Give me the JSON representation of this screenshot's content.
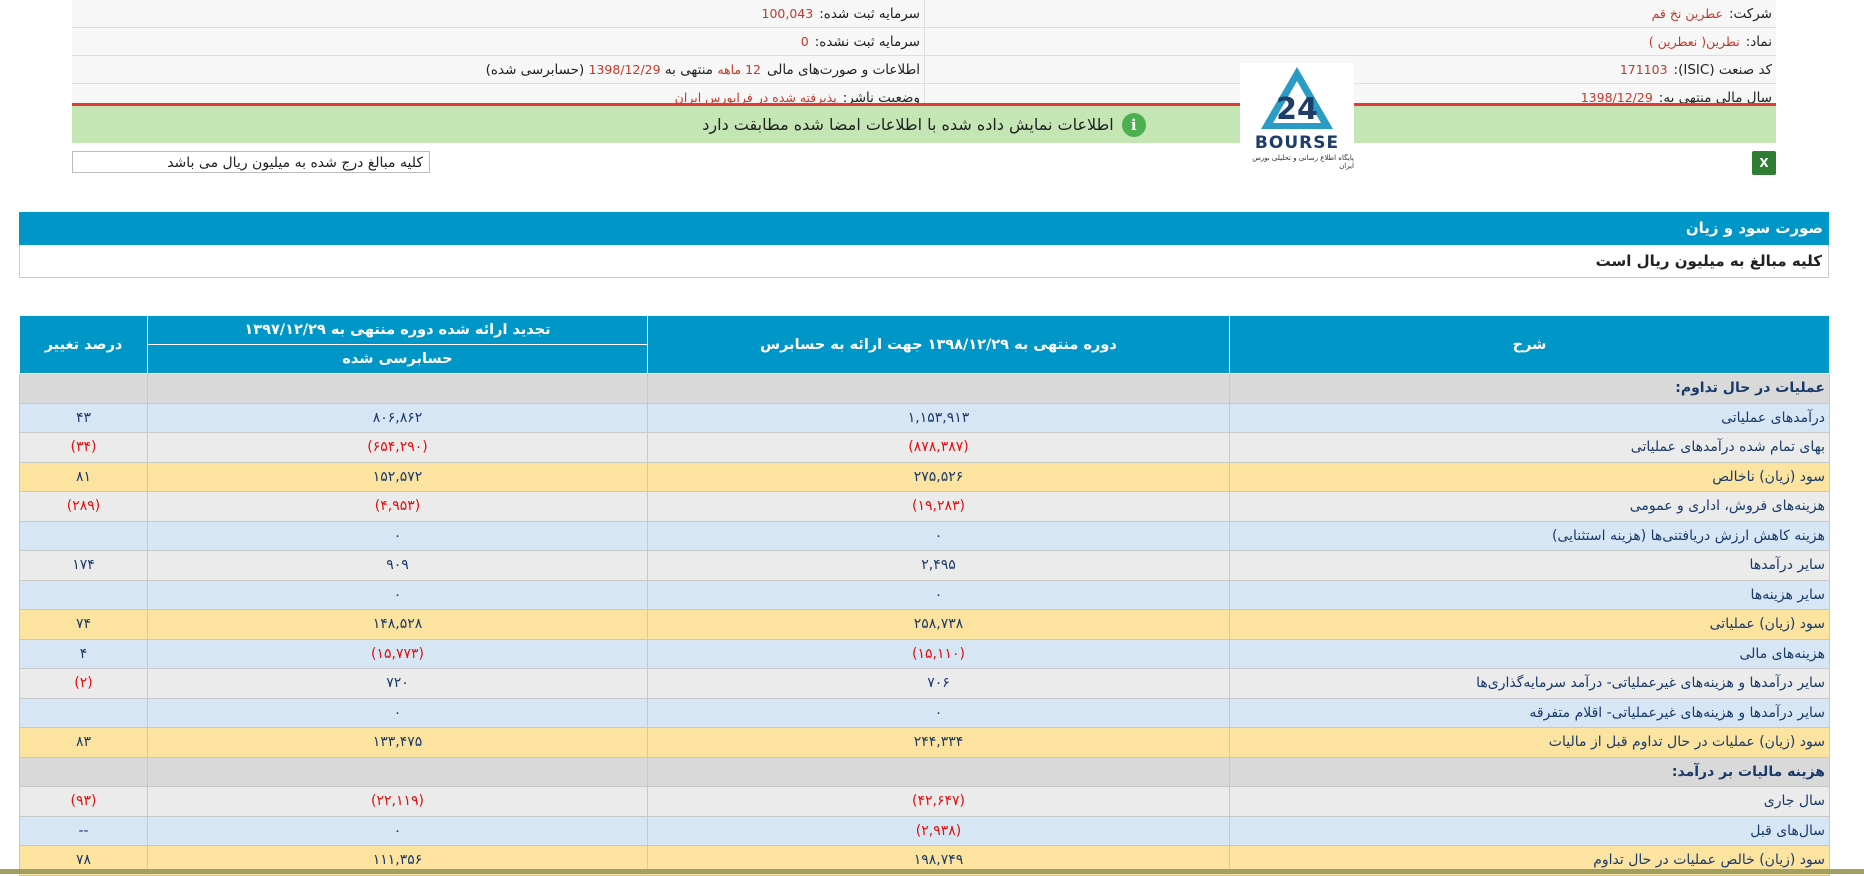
{
  "info": {
    "company_label": "شرکت:",
    "company_value": "عطرین نخ قم",
    "symbol_label": "نماد:",
    "symbol_value": "نطرین( نعطرین )",
    "isic_label": "کد صنعت (ISIC):",
    "isic_value": "171103",
    "fiscal_label": "سال مالی منتهی به:",
    "fiscal_value": "1398/12/29",
    "reg_capital_label": "سرمایه ثبت شده:",
    "reg_capital_value": "100,043",
    "unreg_capital_label": "سرمایه ثبت نشده:",
    "unreg_capital_value": "0",
    "statements_label": "اطلاعات و صورت‌های مالی",
    "statements_months": "12 ماهه",
    "statements_mid": "منتهی به",
    "statements_date": "1398/12/29",
    "statements_audit": "(حسابرسی شده)",
    "publisher_label": "وضعیت ناشر:",
    "publisher_value": "پذیرفته شده در فرابورس ایران"
  },
  "notice": "اطلاعات نمایش داده شده با اطلاعات امضا شده مطابقت دارد",
  "logo": {
    "word": "BOURSE",
    "sub": "پایگاه اطلاع رسانی و تحلیلی بورس ایران",
    "number": "24"
  },
  "unit_note": "کلیه مبالغ درج شده به میلیون ریال می باشد",
  "excel_icon": "X",
  "section_title": "صورت سود و زیان",
  "section_note": "کلیه مبالغ به میلیون ریال است",
  "table": {
    "headers": {
      "desc": "شرح",
      "current": "دوره منتهی به ۱۳۹۸/۱۲/۲۹ جهت ارائه به حسابرس",
      "previous": "تجدید ارائه شده دوره منتهی به ۱۳۹۷/۱۲/۲۹",
      "previous_sub": "حسابرسی شده",
      "change": "درصد تغییر"
    },
    "rows": [
      {
        "style": "cat",
        "desc": "عملیات در حال تداوم:",
        "cur": "",
        "prev": "",
        "chg": ""
      },
      {
        "style": "blue",
        "desc": "درآمدهای عملیاتی",
        "cur": "۱,۱۵۳,۹۱۳",
        "prev": "۸۰۶,۸۶۲",
        "chg": "۴۳"
      },
      {
        "style": "gray",
        "desc": "بهای تمام شده درآمدهای عملیاتی",
        "cur": "(۸۷۸,۳۸۷)",
        "prev": "(۶۵۴,۲۹۰)",
        "chg": "(۳۴)"
      },
      {
        "style": "yel",
        "desc": "سود (زیان) ناخالص",
        "cur": "۲۷۵,۵۲۶",
        "prev": "۱۵۲,۵۷۲",
        "chg": "۸۱"
      },
      {
        "style": "gray",
        "desc": "هزینه‌های فروش، اداری و عمومی",
        "cur": "(۱۹,۲۸۳)",
        "prev": "(۴,۹۵۳)",
        "chg": "(۲۸۹)"
      },
      {
        "style": "blue",
        "desc": "هزینه کاهش ارزش دریافتنی‌ها (هزینه استثنایی)",
        "cur": "۰",
        "prev": "۰",
        "chg": ""
      },
      {
        "style": "gray",
        "desc": "سایر درآمدها",
        "cur": "۲,۴۹۵",
        "prev": "۹۰۹",
        "chg": "۱۷۴"
      },
      {
        "style": "blue",
        "desc": "سایر هزینه‌ها",
        "cur": "۰",
        "prev": "۰",
        "chg": ""
      },
      {
        "style": "yel",
        "desc": "سود (زیان) عملیاتی",
        "cur": "۲۵۸,۷۳۸",
        "prev": "۱۴۸,۵۲۸",
        "chg": "۷۴"
      },
      {
        "style": "blue",
        "desc": "هزینه‌های مالی",
        "cur": "(۱۵,۱۱۰)",
        "prev": "(۱۵,۷۷۳)",
        "chg": "۴"
      },
      {
        "style": "gray",
        "desc": "سایر درآمدها و هزینه‌های غیرعملیاتی- درآمد سرمایه‌گذاری‌ها",
        "cur": "۷۰۶",
        "prev": "۷۲۰",
        "chg": "(۲)"
      },
      {
        "style": "blue",
        "desc": "سایر درآمدها و هزینه‌های غیرعملیاتی- اقلام متفرقه",
        "cur": "۰",
        "prev": "۰",
        "chg": ""
      },
      {
        "style": "yel",
        "desc": "سود (زیان) عملیات در حال تداوم قبل از مالیات",
        "cur": "۲۴۴,۳۳۴",
        "prev": "۱۳۳,۴۷۵",
        "chg": "۸۳"
      },
      {
        "style": "cat",
        "desc": "هزینه مالیات بر درآمد:",
        "cur": "",
        "prev": "",
        "chg": ""
      },
      {
        "style": "gray",
        "desc": "سال جاری",
        "cur": "(۴۲,۶۴۷)",
        "prev": "(۲۲,۱۱۹)",
        "chg": "(۹۳)"
      },
      {
        "style": "blue",
        "desc": "سال‌های قبل",
        "cur": "(۲,۹۳۸)",
        "prev": "۰",
        "chg": "--"
      },
      {
        "style": "yel",
        "desc": "سود (زیان) خالص عملیات در حال تداوم",
        "cur": "۱۹۸,۷۴۹",
        "prev": "۱۱۱,۳۵۶",
        "chg": "۷۸"
      }
    ]
  }
}
